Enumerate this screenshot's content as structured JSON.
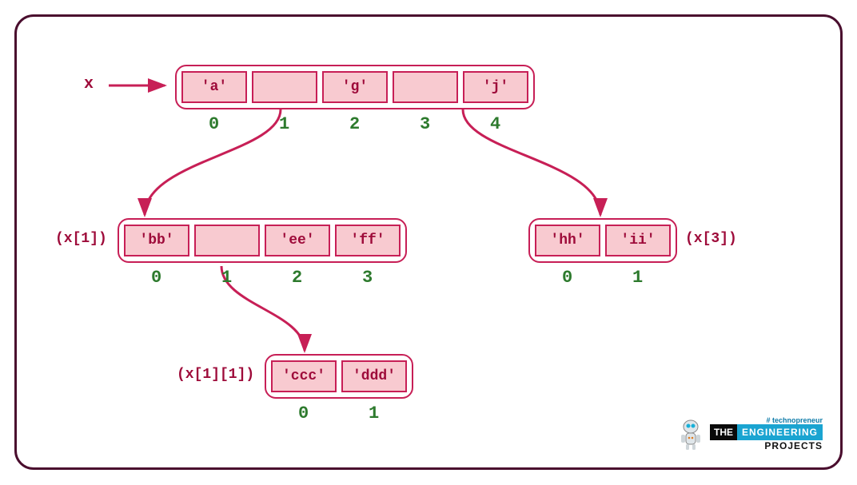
{
  "label_x": "x",
  "arrays": {
    "top": {
      "cells": [
        "'a'",
        "",
        "'g'",
        "",
        "'j'"
      ],
      "indices": [
        "0",
        "1",
        "2",
        "3",
        "4"
      ]
    },
    "left": {
      "label": "(x[1])",
      "cells": [
        "'bb'",
        "",
        "'ee'",
        "'ff'"
      ],
      "indices": [
        "0",
        "1",
        "2",
        "3"
      ]
    },
    "right": {
      "label": "(x[3])",
      "cells": [
        "'hh'",
        "'ii'"
      ],
      "indices": [
        "0",
        "1"
      ]
    },
    "bottom": {
      "label": "(x[1][1])",
      "cells": [
        "'ccc'",
        "'ddd'"
      ],
      "indices": [
        "0",
        "1"
      ]
    }
  },
  "logo": {
    "tagline": "# technopreneur",
    "the": "THE",
    "eng": "ENGINEERING",
    "proj": "PROJECTS"
  }
}
